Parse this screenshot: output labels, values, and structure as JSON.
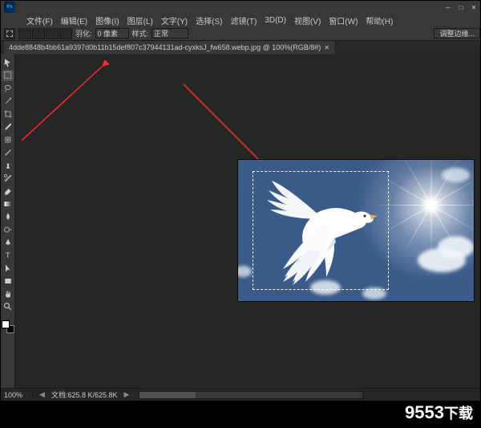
{
  "app": {
    "name": "Ps"
  },
  "menubar": {
    "items": [
      "文件(F)",
      "编辑(E)",
      "图像(I)",
      "图层(L)",
      "文字(Y)",
      "选择(S)",
      "滤镜(T)",
      "3D(D)",
      "视图(V)",
      "窗口(W)",
      "帮助(H)"
    ]
  },
  "options": {
    "feather_label": "羽化:",
    "feather_value": "0 像素",
    "style_label": "样式:",
    "style_value": "正常",
    "refine_edge": "调整边缘..."
  },
  "tab": {
    "filename": "4dde8848b4bb61a9397d0b11b15def807c37944131ad-cyxksJ_fw658.webp.jpg @ 100%(RGB/8#)"
  },
  "tools": [
    "move",
    "marquee",
    "lasso",
    "magic-wand",
    "crop",
    "eyedropper",
    "spot-heal",
    "brush",
    "clone",
    "history-brush",
    "eraser",
    "gradient",
    "blur",
    "dodge",
    "pen",
    "type",
    "path-select",
    "rectangle",
    "hand",
    "zoom"
  ],
  "active_tool_index": 1,
  "status": {
    "zoom": "100%",
    "doc_label": "文档:",
    "doc_info": "625.8 K/625.8K"
  },
  "watermark": {
    "domain": "9553",
    "cn": "下载"
  }
}
